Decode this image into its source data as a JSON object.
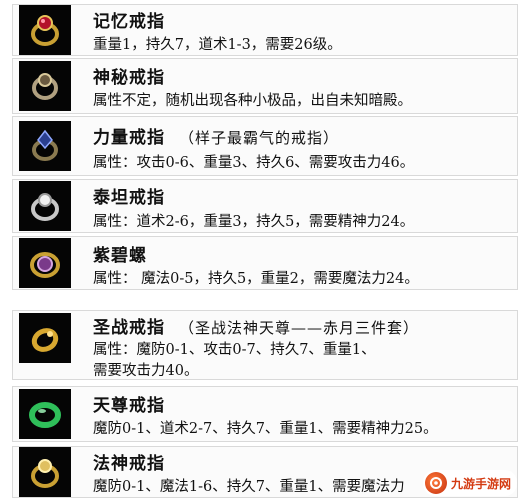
{
  "items": [
    {
      "icon": "gold-ruby-ring-icon",
      "title": "记忆戒指",
      "note": "",
      "lines": [
        "重量1，持久7，道术1-3，需要26级。"
      ]
    },
    {
      "icon": "mystery-ring-icon",
      "title": "神秘戒指",
      "note": "",
      "lines": [
        "属性不定，随机出现各种小极品，出自未知暗殿。"
      ]
    },
    {
      "icon": "power-ring-icon",
      "title": "力量戒指",
      "note": "（样子最霸气的戒指）",
      "lines": [
        "属性：攻击0-6、重量3、持久6、需要攻击力46。"
      ]
    },
    {
      "icon": "titan-ring-icon",
      "title": "泰坦戒指",
      "note": "",
      "lines": [
        "属性：道术2-6，重量3，持久5，需要精神力24。"
      ]
    },
    {
      "icon": "purple-jade-ring-icon",
      "title": "紫碧螺",
      "note": "",
      "lines": [
        "属性：   魔法0-5，持久5，重量2，需要魔法力24。"
      ]
    },
    {
      "icon": "holy-war-ring-icon",
      "title": "圣战戒指",
      "note": "（圣战法神天尊——赤月三件套）",
      "lines": [
        "属性：魔防0-1、攻击0-7、持久7、重量1、",
        "需要攻击力40。"
      ]
    },
    {
      "icon": "green-jade-ring-icon",
      "title": "天尊戒指",
      "note": "",
      "lines": [
        "魔防0-1、道术2-7、持久7、重量1、需要精神力25。"
      ]
    },
    {
      "icon": "mage-god-ring-icon",
      "title": "法神戒指",
      "note": "",
      "lines": [
        "魔防0-1、魔法1-6、持久7、重量1、需要魔法力"
      ]
    }
  ],
  "watermark": {
    "text": "九游手游网"
  },
  "colors": {
    "icon_bg": "#050505",
    "gold": "#c9a033",
    "ruby": "#b3122a",
    "green": "#2fbf5a",
    "purple": "#7a3a8a"
  }
}
